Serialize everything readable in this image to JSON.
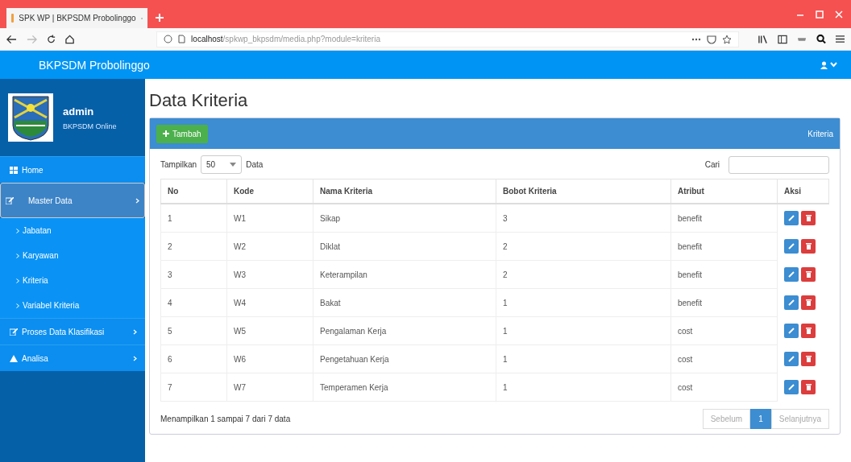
{
  "browser": {
    "tab_title": "SPK WP | BKPSDM Probolinggo",
    "url_host": "localhost",
    "url_path": "/spkwp_bkpsdm/media.php?module=kriteria"
  },
  "app": {
    "brand": "BKPSDM Probolinggo"
  },
  "user": {
    "name": "admin",
    "subtitle": "BKPSDM Online"
  },
  "sidebar": {
    "items": [
      {
        "label": "Home",
        "kind": "grid",
        "selected": false,
        "arrow": false
      },
      {
        "label": "Master Data",
        "kind": "edit",
        "selected": true,
        "arrow": true,
        "children": [
          {
            "label": "Jabatan",
            "selected": false
          },
          {
            "label": "Karyawan",
            "selected": false
          },
          {
            "label": "Kriteria",
            "selected": false
          },
          {
            "label": "Variabel Kriteria",
            "selected": false
          }
        ]
      },
      {
        "label": "Proses Data Klasifikasi",
        "kind": "edit",
        "selected": false,
        "arrow": true
      },
      {
        "label": "Analisa",
        "kind": "warning",
        "selected": false,
        "arrow": true
      }
    ]
  },
  "page_title": "Data Kriteria",
  "panel": {
    "add_button": "Tambah",
    "breadcrumb": "Kriteria"
  },
  "controls": {
    "show_label": "Tampilkan",
    "page_size": "50",
    "show_suffix": "Data",
    "search_label": "Cari"
  },
  "table": {
    "columns": [
      "No",
      "Kode",
      "Nama Kriteria",
      "Bobot Kriteria",
      "Atribut",
      "Aksi"
    ],
    "rows": [
      [
        "1",
        "W1",
        "Sikap",
        "3",
        "benefit"
      ],
      [
        "2",
        "W2",
        "Diklat",
        "2",
        "benefit"
      ],
      [
        "3",
        "W3",
        "Keterampilan",
        "2",
        "benefit"
      ],
      [
        "4",
        "W4",
        "Bakat",
        "1",
        "benefit"
      ],
      [
        "5",
        "W5",
        "Pengalaman Kerja",
        "1",
        "cost"
      ],
      [
        "6",
        "W6",
        "Pengetahuan Kerja",
        "1",
        "cost"
      ],
      [
        "7",
        "W7",
        "Temperamen Kerja",
        "1",
        "cost"
      ]
    ]
  },
  "footer": {
    "info": "Menampilkan 1 sampai 7 dari 7 data",
    "pages": [
      {
        "label": "Sebelum",
        "selected": false,
        "disabled": true
      },
      {
        "label": "1",
        "selected": true,
        "disabled": false
      },
      {
        "label": "Selanjutnya",
        "selected": false,
        "disabled": true
      }
    ]
  }
}
